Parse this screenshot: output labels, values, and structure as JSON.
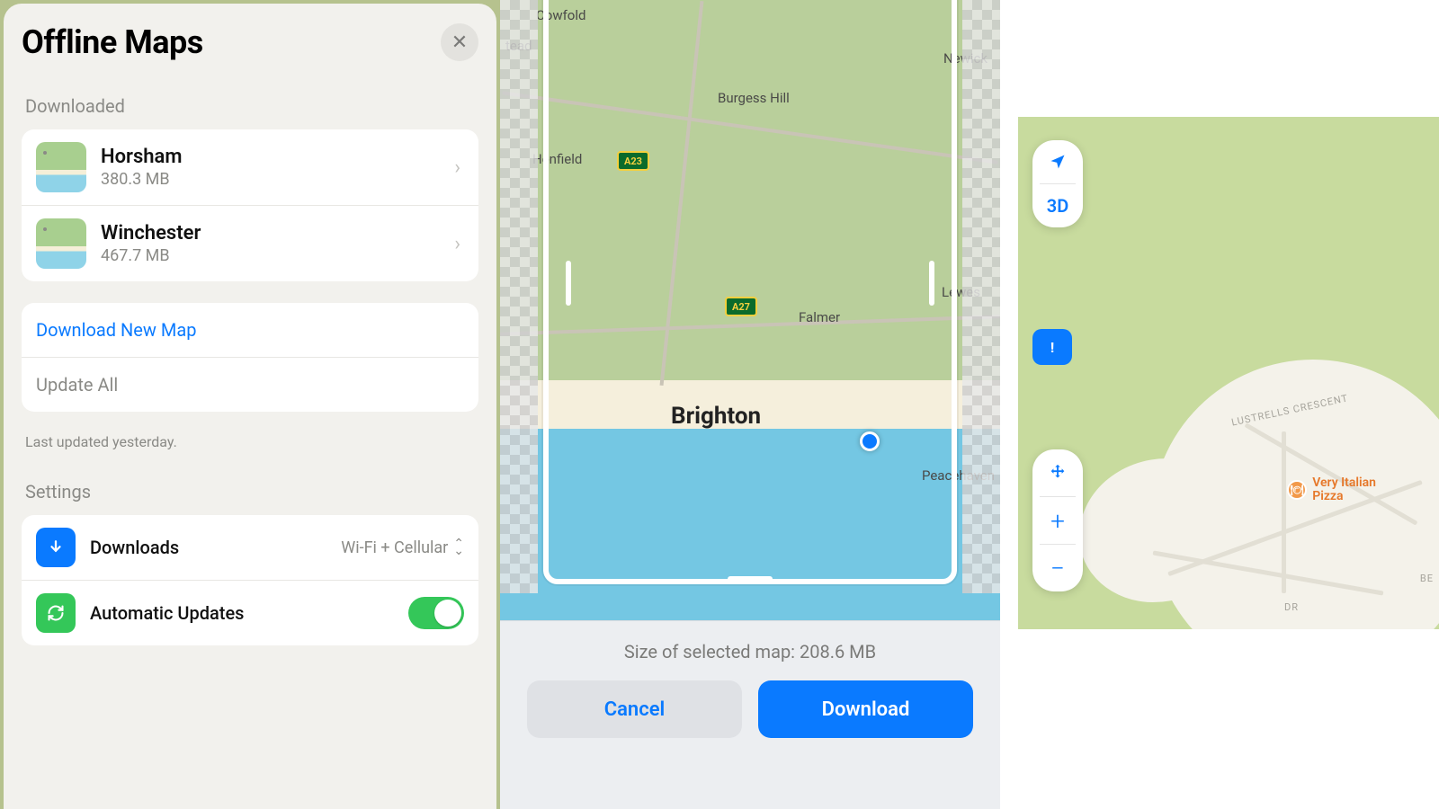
{
  "panel1": {
    "title": "Offline Maps",
    "section_downloaded": "Downloaded",
    "downloaded": [
      {
        "name": "Horsham",
        "size": "380.3 MB"
      },
      {
        "name": "Winchester",
        "size": "467.7 MB"
      }
    ],
    "download_new": "Download New Map",
    "update_all": "Update All",
    "last_updated": "Last updated yesterday.",
    "section_settings": "Settings",
    "settings": {
      "downloads_label": "Downloads",
      "downloads_value": "Wi-Fi + Cellular",
      "auto_updates_label": "Automatic Updates",
      "auto_updates_on": true
    }
  },
  "panel2": {
    "places": {
      "cowfold": "Cowfold",
      "stead_suffix": "tead",
      "henfield": "Henfield",
      "burgess_hill": "Burgess Hill",
      "newick": "Newick",
      "lewes": "Lewes",
      "falmer": "Falmer",
      "brighton": "Brighton",
      "peacehaven": "Peacehaven"
    },
    "roads": {
      "a23": "A23",
      "a27": "A27"
    },
    "size_label": "Size of selected map: 208.6 MB",
    "cancel": "Cancel",
    "download": "Download"
  },
  "panel3": {
    "nav_3d": "3D",
    "poi_name": "Very Italian\nPizza",
    "road_names": {
      "lustrells": "LUSTRELLS CRESCENT",
      "dr": "DR",
      "be": "BE"
    }
  }
}
